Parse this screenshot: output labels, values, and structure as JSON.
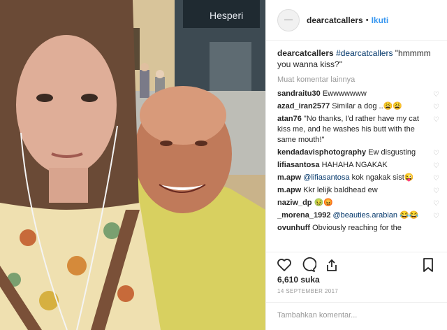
{
  "photo": {
    "sign_text": "Hesperi"
  },
  "header": {
    "username": "dearcatcallers",
    "separator": "•",
    "follow_label": "Ikuti"
  },
  "caption": {
    "username": "dearcatcallers",
    "hashtag": "#dearcatcallers",
    "text": "\"hmmmm you wanna kiss?\""
  },
  "load_more": "Muat komentar lainnya",
  "comments": [
    {
      "user": "sandraitu30",
      "text": "Ewwwwwww"
    },
    {
      "user": "azad_iran2577",
      "text": "Similar a dog ..😩😩"
    },
    {
      "user": "atan76",
      "text": "\"No thanks, I'd rather have my cat kiss me, and he washes his butt with the same mouth!\""
    },
    {
      "user": "kendadavisphotography",
      "text": "Ew disgusting"
    },
    {
      "user": "lifiasantosa",
      "text": "HAHAHA NGAKAK"
    },
    {
      "user": "m.apw",
      "mention": "@lifiasantosa",
      "text": "kok ngakak sist😜"
    },
    {
      "user": "m.apw",
      "text": "Kkr lelijk baldhead ew"
    },
    {
      "user": "naziw_dp",
      "text": "🤢😡"
    },
    {
      "user": "_morena_1992",
      "mention": "@beauties.arabian",
      "text": "😂😂"
    },
    {
      "user": "ovunhuff",
      "text": "Obviously reaching for the"
    }
  ],
  "likes": "6,610 suka",
  "date": "14 SEPTEMBER 2017",
  "add_comment_placeholder": "Tambahkan komentar...",
  "icons": [
    "heart-icon",
    "comment-icon",
    "share-icon",
    "bookmark-icon"
  ]
}
